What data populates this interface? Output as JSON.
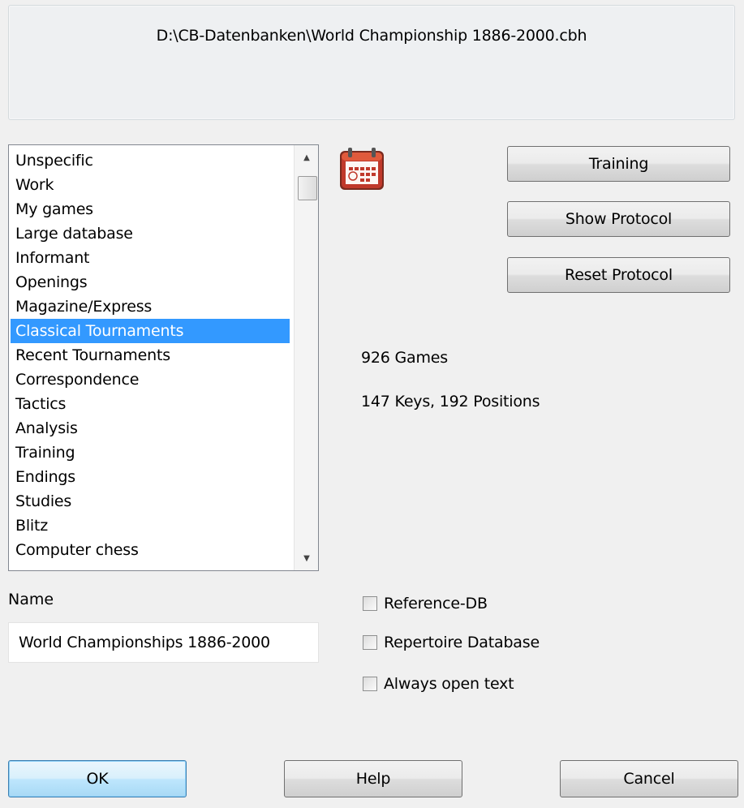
{
  "path": "D:\\CB-Datenbanken\\World Championship 1886-2000.cbh",
  "category_list": {
    "items": [
      "Unspecific",
      "Work",
      "My games",
      "Large database",
      "Informant",
      "Openings",
      "Magazine/Express",
      "Classical Tournaments",
      "Recent Tournaments",
      "Correspondence",
      "Tactics",
      "Analysis",
      "Training",
      "Endings",
      "Studies",
      "Blitz",
      "Computer chess"
    ],
    "selected": "Classical Tournaments"
  },
  "buttons": {
    "training": "Training",
    "show_protocol": "Show Protocol",
    "reset_protocol": "Reset Protocol",
    "ok": "OK",
    "help": "Help",
    "cancel": "Cancel"
  },
  "info": {
    "games": "926 Games",
    "keys": "147 Keys, 192 Positions"
  },
  "name": {
    "label": "Name",
    "value": "World Championships 1886-2000"
  },
  "checkboxes": {
    "reference_db": "Reference-DB",
    "repertoire_db": "Repertoire Database",
    "always_open_text": "Always open text"
  },
  "icons": {
    "calendar": "calendar-icon",
    "scroll_up": "scroll-up-arrow-icon",
    "scroll_down": "scroll-down-arrow-icon"
  },
  "colors": {
    "selection": "#3399ff",
    "default_button": "#bee6fd",
    "calendar_red": "#c0392b"
  }
}
